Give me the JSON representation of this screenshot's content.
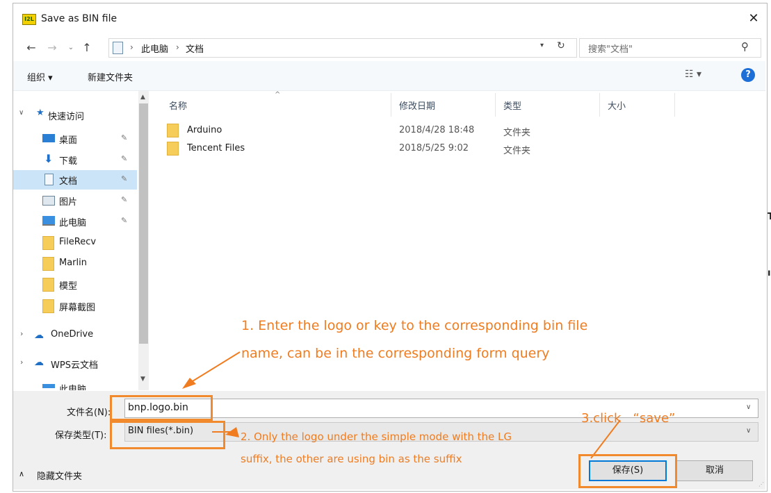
{
  "window": {
    "title": "Save as BIN file",
    "app_icon_text": "I2L",
    "close": "✕"
  },
  "nav": {
    "back": "←",
    "forward": "→",
    "up": "↑",
    "breadcrumb": [
      "此电脑",
      "文档"
    ],
    "search_placeholder": "搜索\"文档\""
  },
  "toolbar": {
    "organize": "组织 ▾",
    "new_folder": "新建文件夹",
    "help": "?"
  },
  "sidebar": {
    "quick_access": "快速访问",
    "items": [
      {
        "label": "桌面",
        "pinned": true,
        "icon": "desktop-icon"
      },
      {
        "label": "下载",
        "pinned": true,
        "icon": "download-icon"
      },
      {
        "label": "文档",
        "pinned": true,
        "icon": "document-icon"
      },
      {
        "label": "图片",
        "pinned": true,
        "icon": "pictures-icon"
      },
      {
        "label": "此电脑",
        "pinned": true,
        "icon": "computer-icon"
      },
      {
        "label": "FileRecv",
        "icon": "folder-icon"
      },
      {
        "label": "Marlin",
        "icon": "folder-icon"
      },
      {
        "label": "模型",
        "icon": "folder-icon"
      },
      {
        "label": "屏幕截图",
        "icon": "folder-icon"
      }
    ],
    "onedrive": "OneDrive",
    "wps": "WPS云文档",
    "partial": "此电脑"
  },
  "columns": {
    "name": "名称",
    "modified": "修改日期",
    "type": "类型",
    "size": "大小"
  },
  "files": [
    {
      "name": "Arduino",
      "modified": "2018/4/28 18:48",
      "type": "文件夹"
    },
    {
      "name": "Tencent Files",
      "modified": "2018/5/25 9:02",
      "type": "文件夹"
    }
  ],
  "footer": {
    "filename_label": "文件名(N):",
    "filename_value": "bnp.logo.bin",
    "type_label": "保存类型(T):",
    "type_value": "BIN files(*.bin)",
    "hide_folders": "隐藏文件夹",
    "save": "保存(S)",
    "cancel": "取消"
  },
  "annotations": {
    "step1_line1": "1. Enter the logo or key to the corresponding bin file",
    "step1_line2": "name, can be in the corresponding form query",
    "step2_line1": "2. Only the logo under the simple mode with the LG",
    "step2_line2": "suffix, the other are using bin as the suffix",
    "step3": "3.click   “save”",
    "color": "#f07c1f"
  }
}
